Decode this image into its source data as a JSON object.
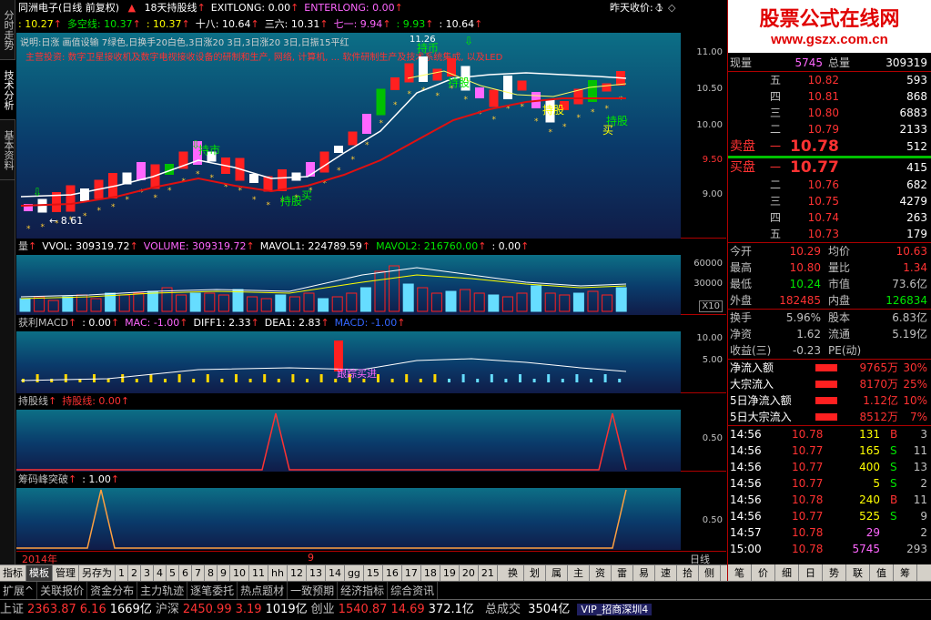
{
  "header": {
    "title": "同洲电子(日线 前复权)",
    "line1_items": [
      {
        "text": "18天持股线",
        "color": "#ffffff"
      },
      {
        "text": "EXITLONG: 0.00",
        "color": "#ffffff"
      },
      {
        "text": "ENTERLONG: 0.00",
        "color": "#ff66ff"
      }
    ],
    "prev_close_label": "昨天收价: 1",
    "line2_items": [
      {
        "text": ": 10.27",
        "color": "#ffff00"
      },
      {
        "text": "多空线: 10.37",
        "color": "#00e600"
      },
      {
        "text": ": 10.37",
        "color": "#ffff00"
      },
      {
        "text": "十八: 10.64",
        "color": "#ffffff"
      },
      {
        "text": "三六: 10.31",
        "color": "#ffffff"
      },
      {
        "text": "七一: 9.94",
        "color": "#ff66ff"
      },
      {
        "text": ": 9.93",
        "color": "#00e600"
      },
      {
        "text": ": 10.64",
        "color": "#ffffff"
      }
    ],
    "note1": "说明:日涨 画值设输 7绿色,日换手20白色,3日涨20 3日,3日涨20 3日,日振15平红",
    "note1_right": "11.26",
    "note2": "主营投资: 数字卫星接收机及数字电视接收设备的研制和生产, 网络, 计算机, ... 软件研制生产及技术系统集成, 以及LED"
  },
  "main_chart": {
    "yticks": [
      "11.00",
      "10.50",
      "10.00",
      "9.50",
      "9.00"
    ],
    "labels": {
      "hold_top": "持币",
      "hold_mid": "持市",
      "hold_stock": "持股",
      "buy": "买",
      "low_price": "← 8.61"
    }
  },
  "volume_panel": {
    "legend": [
      {
        "text": "量",
        "color": "#c0c0c0"
      },
      {
        "text": "VVOL: 309319.72",
        "color": "#ffffff"
      },
      {
        "text": "VOLUME: 309319.72",
        "color": "#ff66ff"
      },
      {
        "text": "MAVOL1: 224789.59",
        "color": "#ffffff"
      },
      {
        "text": "MAVOL2: 216760.00",
        "color": "#00e600"
      },
      {
        "text": ": 0.00",
        "color": "#ffffff"
      }
    ],
    "yticks": [
      "60000",
      "30000"
    ],
    "unit": "X10"
  },
  "macd_panel": {
    "legend": [
      {
        "text": "获利MACD",
        "color": "#c0c0c0"
      },
      {
        "text": ": 0.00",
        "color": "#ffffff"
      },
      {
        "text": "MAC: -1.00",
        "color": "#ff66ff"
      },
      {
        "text": "DIFF1: 2.33",
        "color": "#ffffff"
      },
      {
        "text": "DEA1: 2.83",
        "color": "#ffffff"
      },
      {
        "text": "MACD: -1.00",
        "color": "#3366ff"
      }
    ],
    "yticks": [
      "10.00",
      "5.00",
      "0.00"
    ],
    "label": "跟踪买进"
  },
  "hold_panel": {
    "legend": [
      {
        "text": "持股线",
        "color": "#c0c0c0"
      },
      {
        "text": "持股线: 0.00",
        "color": "#ff3232"
      }
    ],
    "yticks": [
      "0.50"
    ]
  },
  "chip_panel": {
    "legend": [
      {
        "text": "筹码峰突破",
        "color": "#c0c0c0"
      },
      {
        "text": ": 1.00",
        "color": "#ffffff"
      }
    ],
    "yticks": [
      "0.50"
    ]
  },
  "date_axis": {
    "year": "2014年",
    "month": "9",
    "period": "日线"
  },
  "vtabs": [
    "分时走势",
    "技术分析",
    "基本资料"
  ],
  "quote": {
    "logo_big": "股票公式在线网",
    "logo_small": "www.gszx.com.cn",
    "now_label": "现量",
    "now_vol": "5745",
    "total_label": "总量",
    "total_vol": "309319",
    "sell": [
      {
        "level": "五",
        "price": "10.82",
        "vol": "593"
      },
      {
        "level": "四",
        "price": "10.81",
        "vol": "868"
      },
      {
        "level": "三",
        "price": "10.80",
        "vol": "6883"
      },
      {
        "level": "二",
        "price": "10.79",
        "vol": "2133"
      }
    ],
    "sell1": {
      "label": "卖盘",
      "level": "一",
      "price": "10.78",
      "vol": "512"
    },
    "buy1": {
      "label": "买盘",
      "level": "一",
      "price": "10.77",
      "vol": "415"
    },
    "buy": [
      {
        "level": "二",
        "price": "10.76",
        "vol": "682"
      },
      {
        "level": "三",
        "price": "10.75",
        "vol": "4279"
      },
      {
        "level": "四",
        "price": "10.74",
        "vol": "263"
      },
      {
        "level": "五",
        "price": "10.73",
        "vol": "179"
      }
    ],
    "stats": [
      {
        "l1": "今开",
        "v1": "10.29",
        "c1": "#ff3232",
        "l2": "均价",
        "v2": "10.63",
        "c2": "#ff3232"
      },
      {
        "l1": "最高",
        "v1": "10.80",
        "c1": "#ff3232",
        "l2": "量比",
        "v2": "1.34",
        "c2": "#ff3232"
      },
      {
        "l1": "最低",
        "v1": "10.24",
        "c1": "#00e600",
        "l2": "市值",
        "v2": "73.6亿",
        "c2": "#c0c0c0"
      },
      {
        "l1": "外盘",
        "v1": "182485",
        "c1": "#ff3232",
        "l2": "内盘",
        "v2": "126834",
        "c2": "#00e600"
      }
    ],
    "stats2": [
      {
        "l1": "换手",
        "v1": "5.96%",
        "c1": "#c0c0c0",
        "l2": "股本",
        "v2": "6.83亿",
        "c2": "#c0c0c0"
      },
      {
        "l1": "净资",
        "v1": "1.62",
        "c1": "#c0c0c0",
        "l2": "流通",
        "v2": "5.19亿",
        "c2": "#c0c0c0"
      },
      {
        "l1": "收益(三)",
        "v1": "-0.23",
        "c1": "#c0c0c0",
        "l2": "PE(动)",
        "v2": "",
        "c2": "#c0c0c0"
      }
    ],
    "flows": [
      {
        "label": "净流入额",
        "value": "9765万",
        "pct": "30%"
      },
      {
        "label": "大宗流入",
        "value": "8170万",
        "pct": "25%"
      },
      {
        "label": "5日净流入额",
        "value": "1.12亿",
        "pct": "10%"
      },
      {
        "label": "5日大宗流入",
        "value": "8512万",
        "pct": "7%"
      }
    ],
    "ticks": [
      {
        "time": "14:56",
        "price": "10.78",
        "vol": "131",
        "side": "B",
        "n": "3"
      },
      {
        "time": "14:56",
        "price": "10.77",
        "vol": "165",
        "side": "S",
        "n": "11"
      },
      {
        "time": "14:56",
        "price": "10.77",
        "vol": "400",
        "side": "S",
        "n": "13"
      },
      {
        "time": "14:56",
        "price": "10.77",
        "vol": "5",
        "side": "S",
        "n": "2"
      },
      {
        "time": "14:56",
        "price": "10.78",
        "vol": "240",
        "side": "B",
        "n": "11"
      },
      {
        "time": "14:56",
        "price": "10.77",
        "vol": "525",
        "side": "S",
        "n": "9"
      },
      {
        "time": "14:57",
        "price": "10.78",
        "vol": "29",
        "side": "",
        "n": "2"
      },
      {
        "time": "15:00",
        "price": "10.78",
        "vol": "5745",
        "side": "",
        "n": "293"
      }
    ]
  },
  "bottom_tabs": [
    "指标",
    "模板",
    "管理",
    "另存为",
    "1",
    "2",
    "3",
    "4",
    "5",
    "6",
    "7",
    "8",
    "9",
    "10",
    "11",
    "hh",
    "12",
    "13",
    "14",
    "gg",
    "15",
    "16",
    "17",
    "18",
    "19",
    "20",
    "21"
  ],
  "bottom_right_tabs": [
    "换",
    "划",
    "属",
    "主",
    "资",
    "雷",
    "易",
    "速",
    "拾",
    "侧"
  ],
  "bottom_right_tabs2": [
    "笔",
    "价",
    "细",
    "日",
    "势",
    "联",
    "值",
    "筹"
  ],
  "bottom_menu": [
    "扩展^",
    "关联报价",
    "资金分布",
    "主力轨迹",
    "逐笔委托",
    "热点题材",
    "一致预期",
    "经济指标",
    "综合资讯"
  ],
  "status": {
    "items": [
      {
        "label": "上证",
        "value": "2363.87",
        "change": "6.16",
        "amount": "1669亿"
      },
      {
        "label": "沪深",
        "value": "2450.99",
        "change": "3.19",
        "amount": "1019亿"
      },
      {
        "label": "创业",
        "value": "1540.87",
        "change": "14.69",
        "amount": "372.1亿"
      }
    ],
    "total_label": "总成交",
    "total_value": "3504亿",
    "server": "VIP_招商深圳4"
  }
}
